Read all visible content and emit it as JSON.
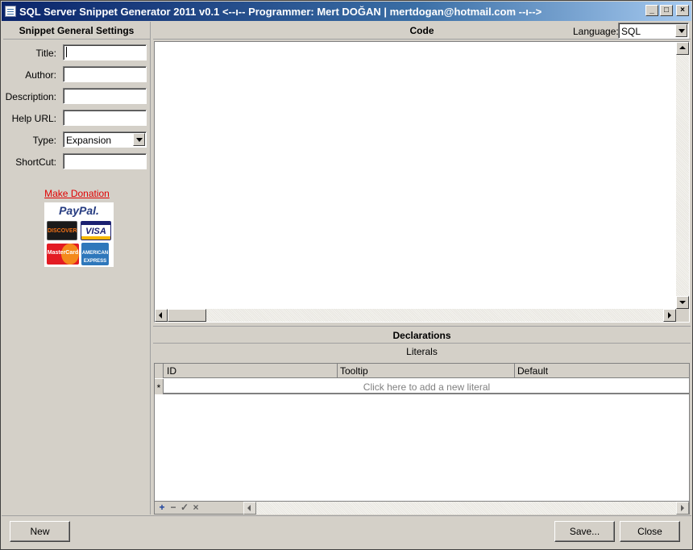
{
  "window": {
    "title": "SQL Server Snippet Generator 2011 v0.1   <--ı--  Programmer: Mert DOĞAN | mertdogan@hotmail.com  --ı-->",
    "minimize": "_",
    "maximize": "□",
    "close": "×"
  },
  "left": {
    "header": "Snippet General Settings",
    "fields": {
      "title_label": "Title:",
      "title_value": "",
      "author_label": "Author:",
      "author_value": "",
      "description_label": "Description:",
      "description_value": "",
      "help_url_label": "Help URL:",
      "help_url_value": "",
      "type_label": "Type:",
      "type_value": "Expansion",
      "shortcut_label": "ShortCut:",
      "shortcut_value": ""
    },
    "donation_link": "Make Donation",
    "payment": {
      "paypal": "PayPal.",
      "discover": "DISCOVER",
      "visa": "VISA",
      "mastercard": "MasterCard",
      "amex": "AMERICAN EXPRESS"
    }
  },
  "code": {
    "header": "Code",
    "language_label": "Language:",
    "language_value": "SQL",
    "content": ""
  },
  "declarations": {
    "header": "Declarations",
    "literals_label": "Literals",
    "columns": [
      "ID",
      "Tooltip",
      "Default"
    ],
    "new_row_marker": "*",
    "new_row_hint": "Click here to add a new literal",
    "toolbar": {
      "add": "+",
      "remove": "−",
      "edit": "✓",
      "cancel": "×"
    }
  },
  "buttons": {
    "new": "New",
    "save": "Save...",
    "close": "Close"
  }
}
